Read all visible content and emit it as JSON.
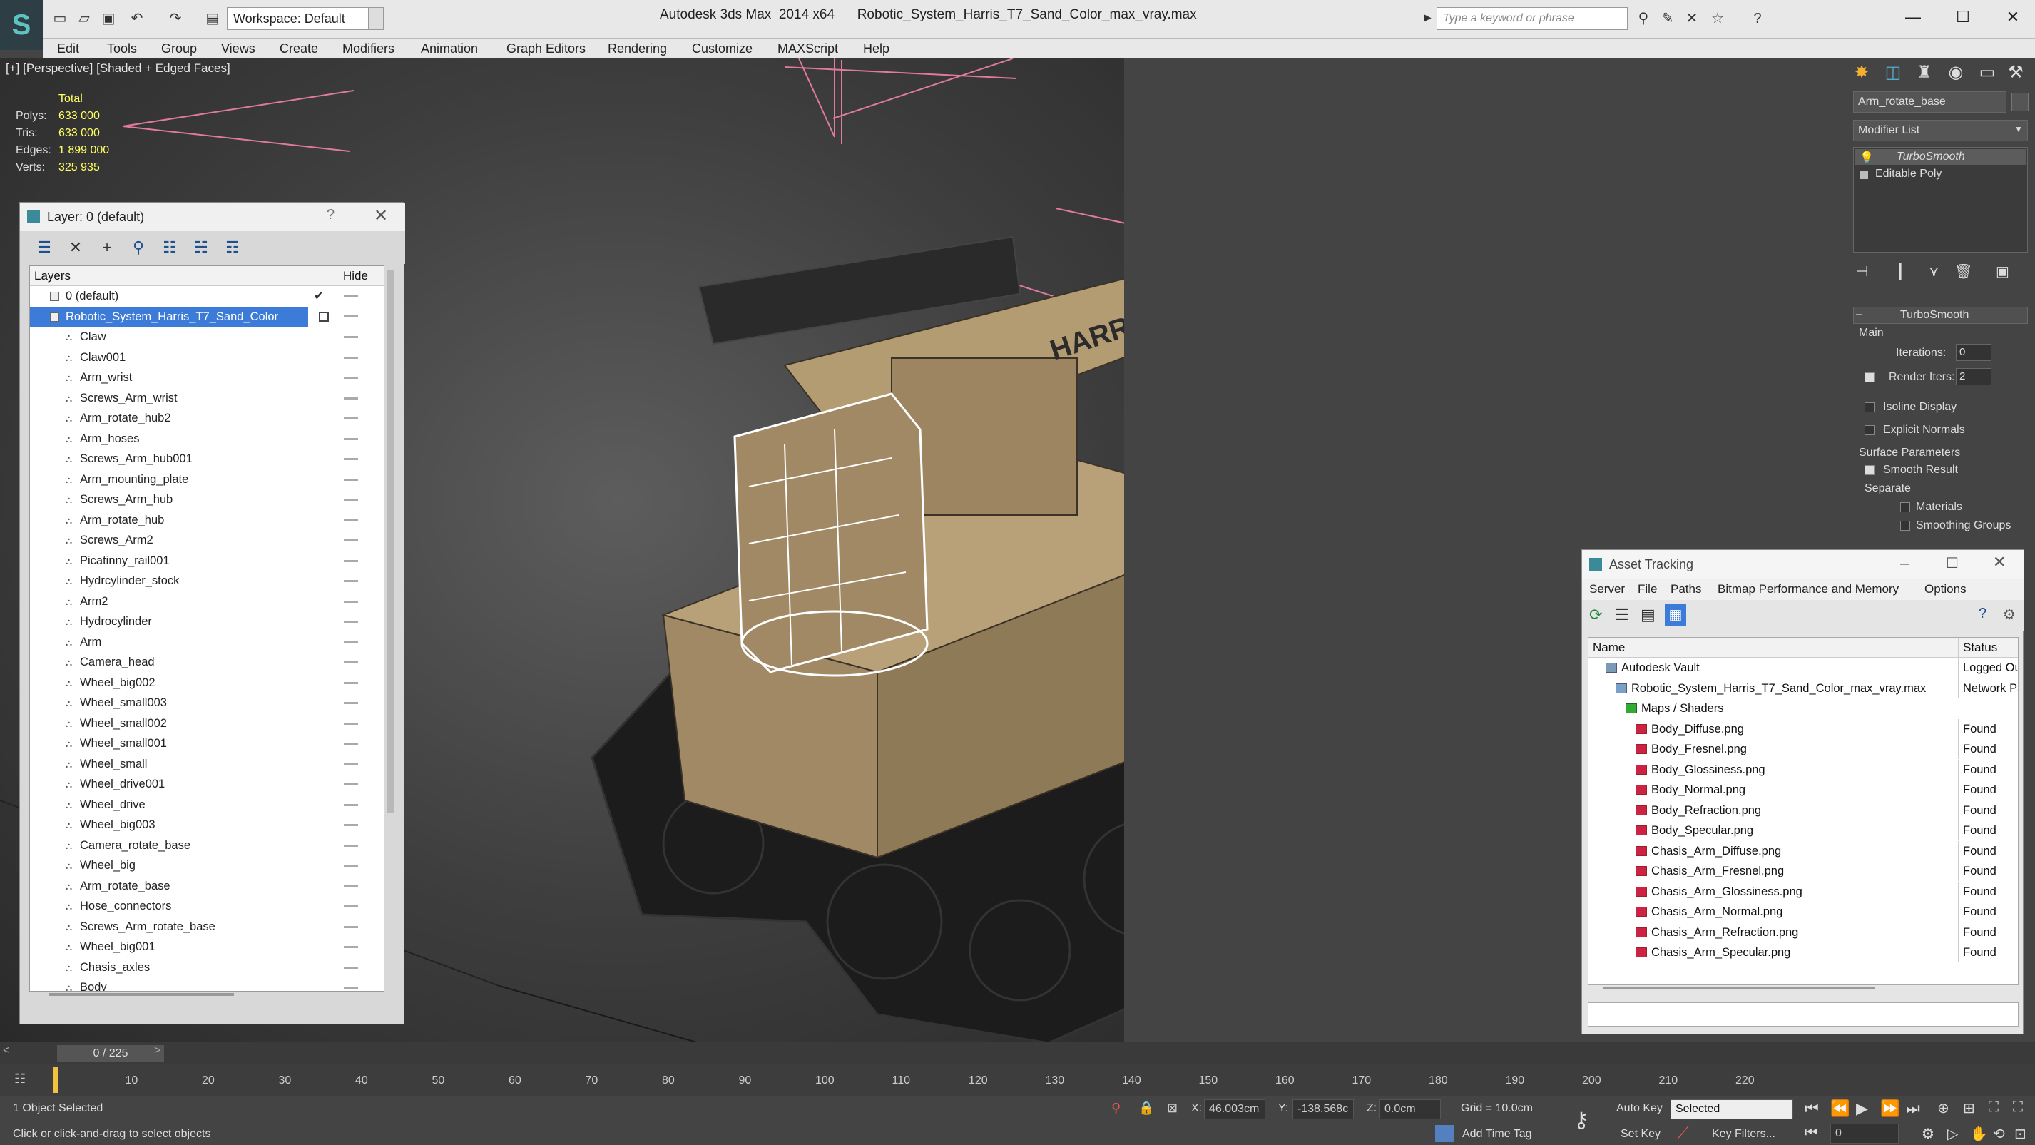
{
  "titlebar": {
    "workspace": "Workspace: Default",
    "title": "Autodesk 3ds Max  2014 x64      Robotic_System_Harris_T7_Sand_Color_max_vray.max",
    "search_placeholder": "Type a keyword or phrase"
  },
  "menubar": [
    "Edit",
    "Tools",
    "Group",
    "Views",
    "Create",
    "Modifiers",
    "Animation",
    "Graph Editors",
    "Rendering",
    "Customize",
    "MAXScript",
    "Help"
  ],
  "viewport": {
    "label": "[+] [Perspective] [Shaded + Edged Faces]",
    "stats": {
      "header": "Total",
      "polys_label": "Polys:",
      "polys": "633 000",
      "tris_label": "Tris:",
      "tris": "633 000",
      "edges_label": "Edges:",
      "edges": "1 899 000",
      "verts_label": "Verts:",
      "verts": "325 935"
    },
    "model_text": "HARRIS"
  },
  "layer_dialog": {
    "title": "Layer: 0 (default)",
    "help": "?",
    "col_layers": "Layers",
    "col_hide": "Hide",
    "default_layer": "0 (default)",
    "selected_layer": "Robotic_System_Harris_T7_Sand_Color",
    "objects": [
      "Claw",
      "Claw001",
      "Arm_wrist",
      "Screws_Arm_wrist",
      "Arm_rotate_hub2",
      "Arm_hoses",
      "Screws_Arm_hub001",
      "Arm_mounting_plate",
      "Screws_Arm_hub",
      "Arm_rotate_hub",
      "Screws_Arm2",
      "Picatinny_rail001",
      "Hydrcylinder_stock",
      "Arm2",
      "Hydrocylinder",
      "Arm",
      "Camera_head",
      "Wheel_big002",
      "Wheel_small003",
      "Wheel_small002",
      "Wheel_small001",
      "Wheel_small",
      "Wheel_drive001",
      "Wheel_drive",
      "Wheel_big003",
      "Camera_rotate_base",
      "Wheel_big",
      "Arm_rotate_base",
      "Hose_connectors",
      "Screws_Arm_rotate_base",
      "Wheel_big001",
      "Chasis_axles",
      "Body"
    ]
  },
  "command_panel": {
    "object_name": "Arm_rotate_base",
    "modifier_list": "Modifier List",
    "stack": [
      "TurboSmooth",
      "Editable Poly"
    ],
    "rollout_title": "TurboSmooth",
    "main": "Main",
    "iterations_label": "Iterations:",
    "iterations": "0",
    "render_iters_label": "Render Iters:",
    "render_iters": "2",
    "isoline": "Isoline Display",
    "explicit_normals": "Explicit Normals",
    "surface_params": "Surface Parameters",
    "smooth_result": "Smooth Result",
    "separate": "Separate",
    "materials": "Materials",
    "smoothing_groups": "Smoothing Groups"
  },
  "asset_tracking": {
    "title": "Asset Tracking",
    "menu": [
      "Server",
      "File",
      "Paths",
      "Bitmap Performance and Memory",
      "Options"
    ],
    "col_name": "Name",
    "col_status": "Status",
    "rows": [
      {
        "name": "Autodesk Vault",
        "status": "Logged Ou",
        "indent": 1
      },
      {
        "name": "Robotic_System_Harris_T7_Sand_Color_max_vray.max",
        "status": "Network Pa",
        "indent": 2
      },
      {
        "name": "Maps / Shaders",
        "status": "",
        "indent": 3
      },
      {
        "name": "Body_Diffuse.png",
        "status": "Found",
        "indent": 4
      },
      {
        "name": "Body_Fresnel.png",
        "status": "Found",
        "indent": 4
      },
      {
        "name": "Body_Glossiness.png",
        "status": "Found",
        "indent": 4
      },
      {
        "name": "Body_Normal.png",
        "status": "Found",
        "indent": 4
      },
      {
        "name": "Body_Refraction.png",
        "status": "Found",
        "indent": 4
      },
      {
        "name": "Body_Specular.png",
        "status": "Found",
        "indent": 4
      },
      {
        "name": "Chasis_Arm_Diffuse.png",
        "status": "Found",
        "indent": 4
      },
      {
        "name": "Chasis_Arm_Fresnel.png",
        "status": "Found",
        "indent": 4
      },
      {
        "name": "Chasis_Arm_Glossiness.png",
        "status": "Found",
        "indent": 4
      },
      {
        "name": "Chasis_Arm_Normal.png",
        "status": "Found",
        "indent": 4
      },
      {
        "name": "Chasis_Arm_Refraction.png",
        "status": "Found",
        "indent": 4
      },
      {
        "name": "Chasis_Arm_Specular.png",
        "status": "Found",
        "indent": 4
      }
    ]
  },
  "timeline": {
    "frame": "0 / 225",
    "ticks": [
      "0",
      "10",
      "20",
      "30",
      "40",
      "50",
      "60",
      "70",
      "80",
      "90",
      "100",
      "110",
      "120",
      "130",
      "140",
      "150",
      "160",
      "170",
      "180",
      "190",
      "200",
      "210",
      "220"
    ]
  },
  "status": {
    "selected": "1 Object Selected",
    "prompt": "Click or click-and-drag to select objects",
    "x_label": "X:",
    "x": "46.003cm",
    "y_label": "Y:",
    "y": "-138.568c",
    "z_label": "Z:",
    "z": "0.0cm",
    "grid": "Grid = 10.0cm",
    "add_time_tag": "Add Time Tag",
    "auto_key": "Auto Key",
    "set_key": "Set Key",
    "selected_dropdown": "Selected",
    "key_filters": "Key Filters...",
    "frame_field": "0"
  }
}
